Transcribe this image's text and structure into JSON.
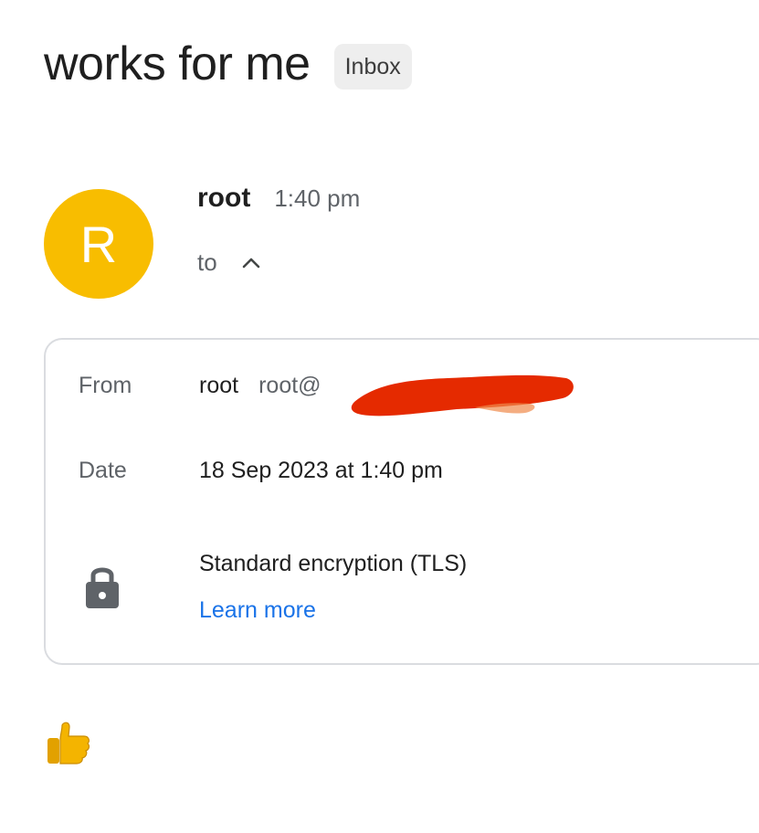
{
  "email": {
    "subject": "works for me",
    "label": "Inbox",
    "sender": {
      "avatar_initial": "R",
      "name": "root",
      "time": "1:40 pm",
      "to_label": "to"
    },
    "details": {
      "from_label": "From",
      "from_name": "root",
      "from_email_visible": "root@",
      "date_label": "Date",
      "date_value": "18 Sep 2023 at 1:40 pm",
      "security_value": "Standard encryption (TLS)",
      "learn_more_label": "Learn more"
    },
    "body_emoji": "thumbs-up-emoji"
  },
  "colors": {
    "avatar": "#f8bd00",
    "link": "#1a73e8",
    "redaction": "#e52a00",
    "chip_bg": "#eeeeee"
  }
}
